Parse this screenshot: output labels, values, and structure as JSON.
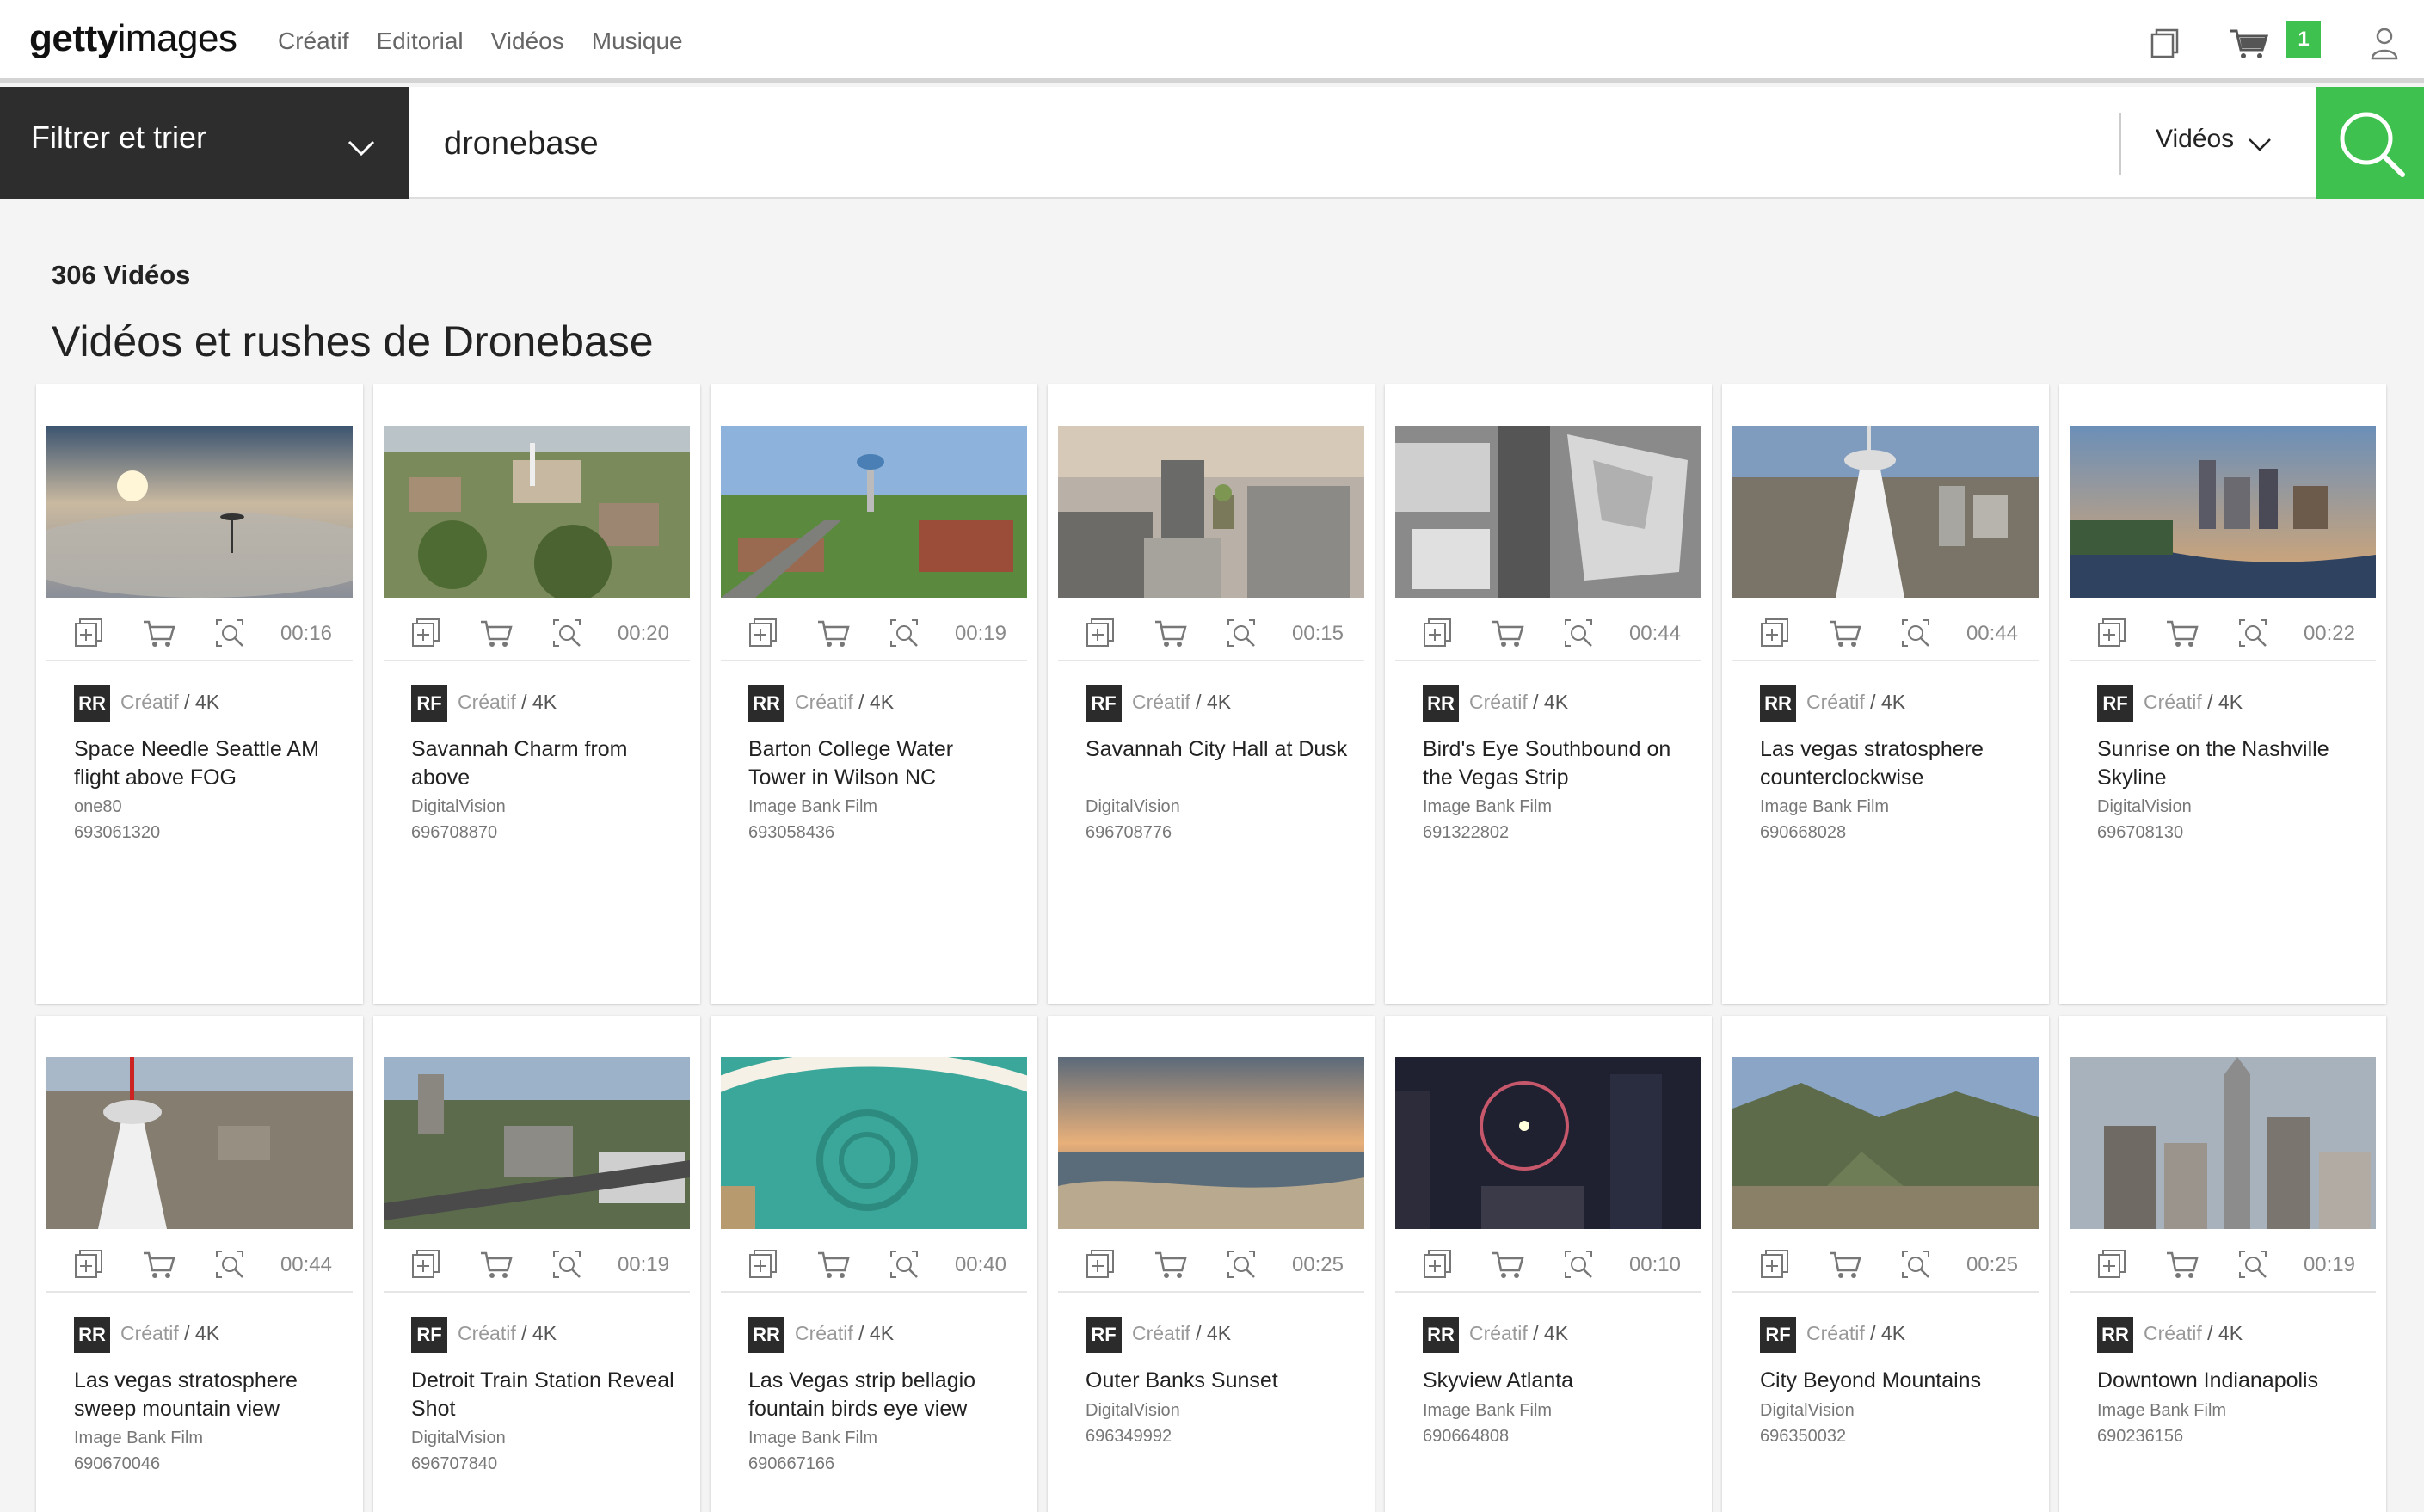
{
  "brand": {
    "logo_bold": "getty",
    "logo_light": "images"
  },
  "nav": [
    "Créatif",
    "Editorial",
    "Vidéos",
    "Musique"
  ],
  "cart_count": "1",
  "filter": {
    "label": "Filtrer et trier"
  },
  "search": {
    "query": "dronebase",
    "media_type": "Vidéos"
  },
  "results": {
    "count_label": "306 Vidéos",
    "heading": "Vidéos et rushes de Dronebase"
  },
  "colors": {
    "accent": "#3ec14e",
    "dark": "#2d2d2d"
  },
  "cards": [
    {
      "license": "RR",
      "category": "Créatif",
      "quality": "4K",
      "duration": "00:16",
      "title": "Space Needle Seattle AM flight above FOG",
      "collection": "one80",
      "id": "693061320"
    },
    {
      "license": "RF",
      "category": "Créatif",
      "quality": "4K",
      "duration": "00:20",
      "title": "Savannah Charm from above",
      "collection": "DigitalVision",
      "id": "696708870"
    },
    {
      "license": "RR",
      "category": "Créatif",
      "quality": "4K",
      "duration": "00:19",
      "title": "Barton College Water Tower in Wilson NC",
      "collection": "Image Bank Film",
      "id": "693058436"
    },
    {
      "license": "RF",
      "category": "Créatif",
      "quality": "4K",
      "duration": "00:15",
      "title": "Savannah City Hall at Dusk",
      "collection": "DigitalVision",
      "id": "696708776"
    },
    {
      "license": "RR",
      "category": "Créatif",
      "quality": "4K",
      "duration": "00:44",
      "title": "Bird's Eye Southbound on the Vegas Strip",
      "collection": "Image Bank Film",
      "id": "691322802"
    },
    {
      "license": "RR",
      "category": "Créatif",
      "quality": "4K",
      "duration": "00:44",
      "title": "Las vegas stratosphere counterclockwise",
      "collection": "Image Bank Film",
      "id": "690668028"
    },
    {
      "license": "RF",
      "category": "Créatif",
      "quality": "4K",
      "duration": "00:22",
      "title": "Sunrise on the Nashville Skyline",
      "collection": "DigitalVision",
      "id": "696708130"
    },
    {
      "license": "RR",
      "category": "Créatif",
      "quality": "4K",
      "duration": "00:44",
      "title": "Las vegas stratosphere sweep mountain view",
      "collection": "Image Bank Film",
      "id": "690670046"
    },
    {
      "license": "RF",
      "category": "Créatif",
      "quality": "4K",
      "duration": "00:19",
      "title": "Detroit Train Station Reveal Shot",
      "collection": "DigitalVision",
      "id": "696707840"
    },
    {
      "license": "RR",
      "category": "Créatif",
      "quality": "4K",
      "duration": "00:40",
      "title": "Las Vegas strip bellagio fountain birds eye view",
      "collection": "Image Bank Film",
      "id": "690667166"
    },
    {
      "license": "RF",
      "category": "Créatif",
      "quality": "4K",
      "duration": "00:25",
      "title": "Outer Banks Sunset",
      "collection": "DigitalVision",
      "id": "696349992"
    },
    {
      "license": "RR",
      "category": "Créatif",
      "quality": "4K",
      "duration": "00:10",
      "title": "Skyview Atlanta",
      "collection": "Image Bank Film",
      "id": "690664808"
    },
    {
      "license": "RF",
      "category": "Créatif",
      "quality": "4K",
      "duration": "00:25",
      "title": "City Beyond Mountains",
      "collection": "DigitalVision",
      "id": "696350032"
    },
    {
      "license": "RR",
      "category": "Créatif",
      "quality": "4K",
      "duration": "00:19",
      "title": "Downtown Indianapolis",
      "collection": "Image Bank Film",
      "id": "690236156"
    }
  ]
}
